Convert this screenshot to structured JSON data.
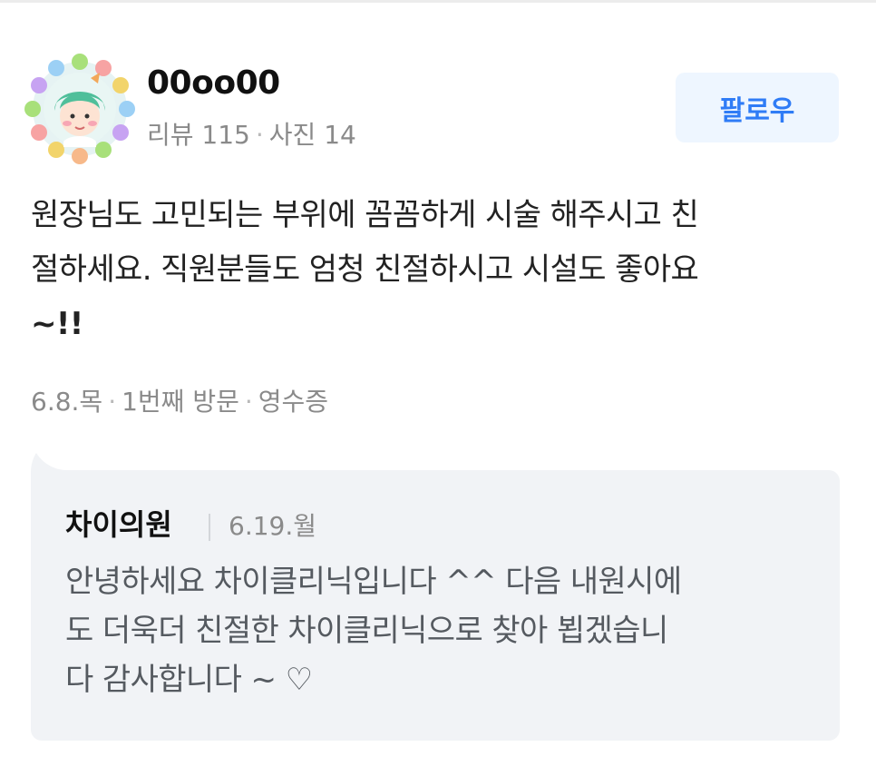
{
  "review": {
    "user": {
      "name": "00oo00",
      "stats": {
        "reviews": "리뷰 115",
        "separator": "·",
        "photos": "사진 14"
      },
      "avatar_icon": "avatar-flower-wreath-icon"
    },
    "follow_label": "팔로우",
    "text_lines": [
      "원장님도 고민되는 부위에 꼼꼼하게 시술 해주시고 친",
      "절하세요. 직원분들도 엄청 친절하시고 시설도 좋아요",
      "~!!"
    ],
    "meta": {
      "date": "6.8.목",
      "separator": "·",
      "visit": "1번째 방문",
      "verification": "영수증"
    },
    "reply": {
      "author": "차이의원",
      "date": "6.19.월",
      "text_lines": [
        "안녕하세요 차이클리닉입니다 ^^ 다음 내원시에",
        "도 더욱더 친절한 차이클리닉으로 찾아 뵙겠습니",
        "다 감사합니다 ~ ♡"
      ]
    }
  },
  "colors": {
    "accent": "#2f7cf6",
    "follow_bg": "#eef6ff",
    "muted_text": "#8a8a8a",
    "reply_bg": "#f1f3f6"
  }
}
